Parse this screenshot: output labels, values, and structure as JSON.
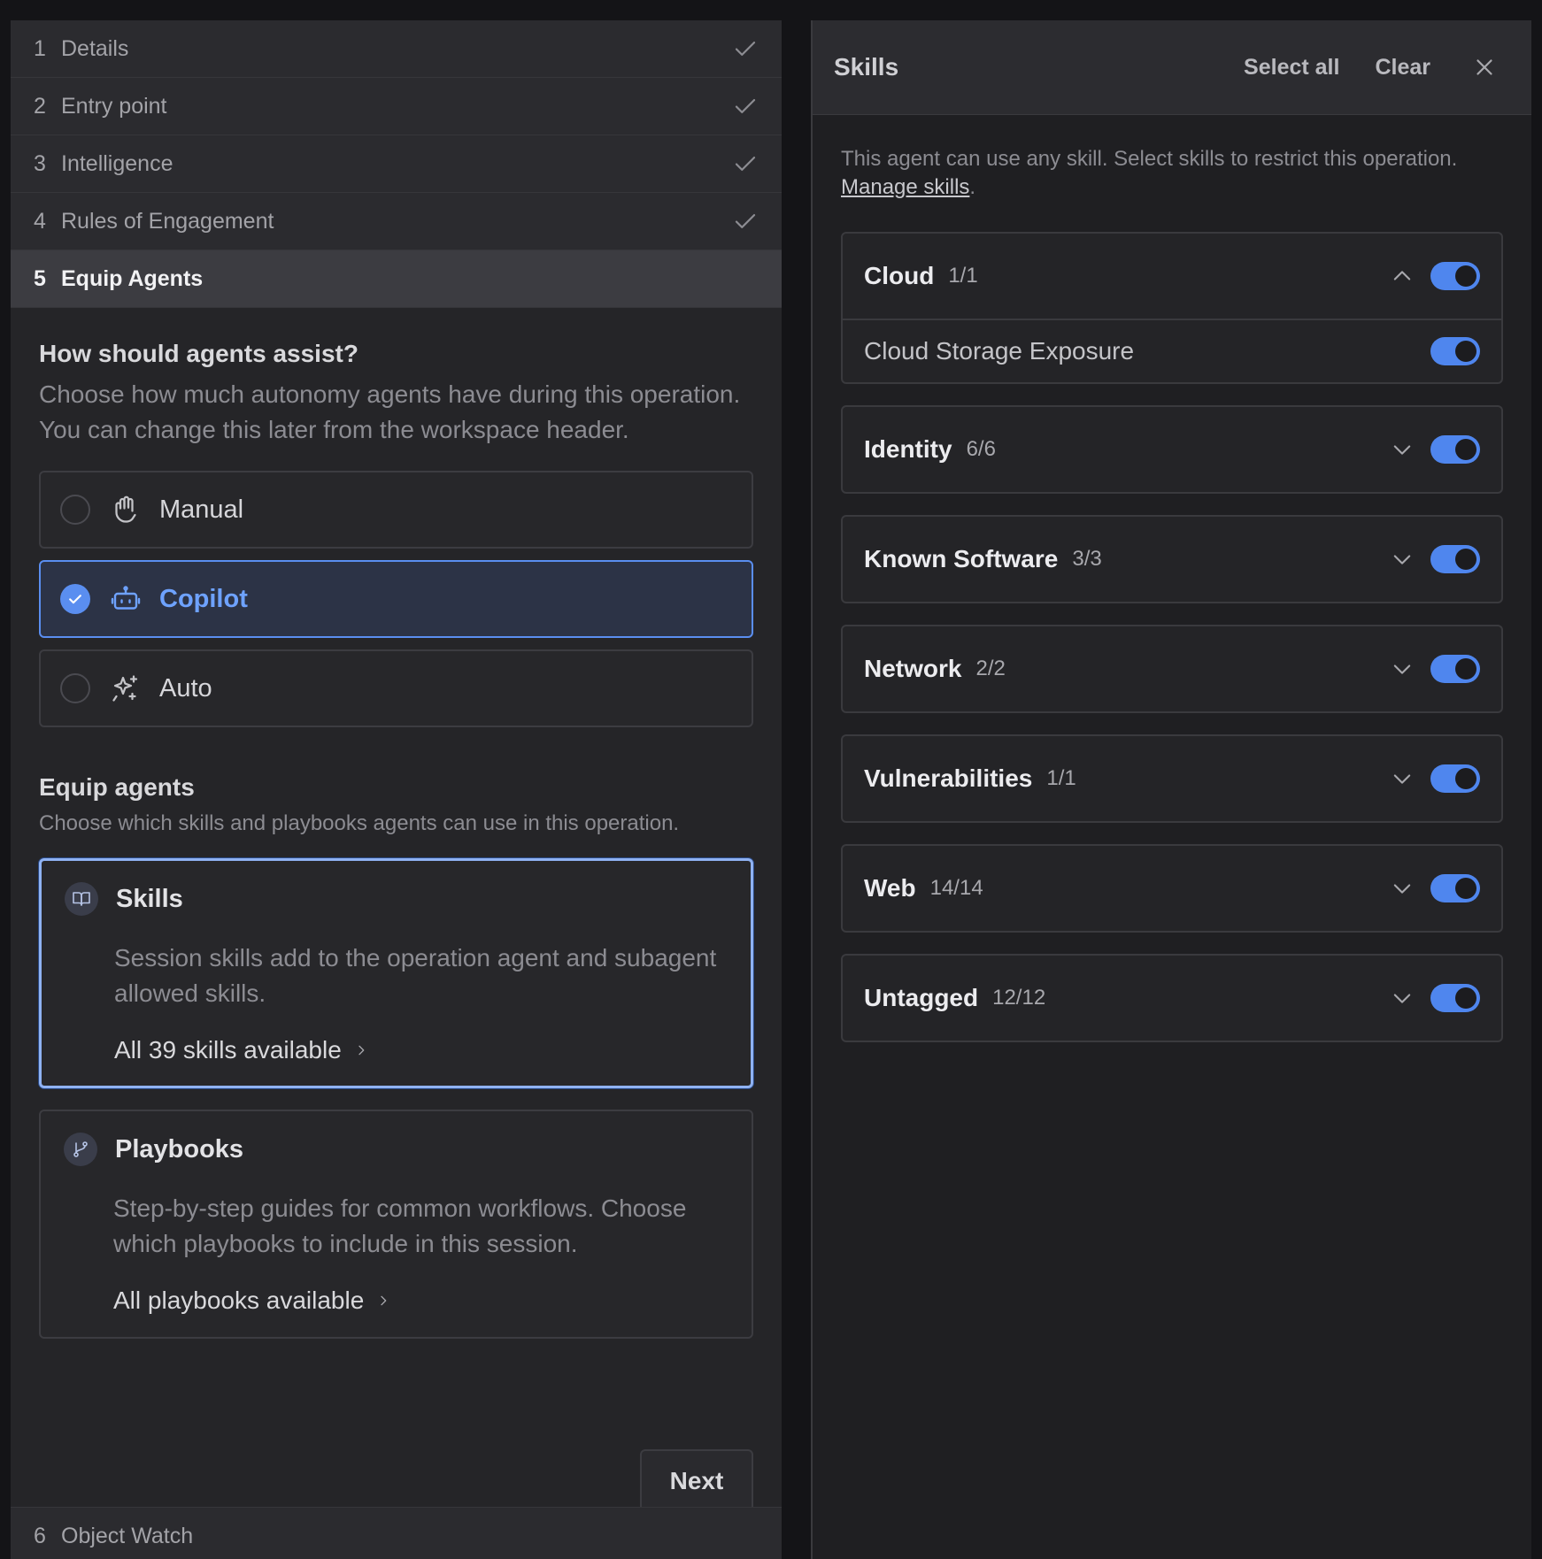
{
  "wizard": {
    "steps": [
      {
        "num": "1",
        "label": "Details"
      },
      {
        "num": "2",
        "label": "Entry point"
      },
      {
        "num": "3",
        "label": "Intelligence"
      },
      {
        "num": "4",
        "label": "Rules of Engagement"
      },
      {
        "num": "5",
        "label": "Equip Agents"
      },
      {
        "num": "6",
        "label": "Object Watch"
      }
    ],
    "assist": {
      "title": "How should agents assist?",
      "description": "Choose how much autonomy agents have during this operation. You can change this later from the workspace header.",
      "options": [
        {
          "label": "Manual",
          "icon": "hand-icon",
          "selected": false
        },
        {
          "label": "Copilot",
          "icon": "robot-icon",
          "selected": true
        },
        {
          "label": "Auto",
          "icon": "sparkles-icon",
          "selected": false
        }
      ]
    },
    "equip": {
      "title": "Equip agents",
      "description": "Choose which skills and playbooks agents can use in this operation.",
      "skills": {
        "title": "Skills",
        "description": "Session skills add to the operation agent and subagent allowed skills.",
        "link": "All 39 skills available"
      },
      "playbooks": {
        "title": "Playbooks",
        "description": "Step-by-step guides for common workflows. Choose which playbooks to include in this session.",
        "link": "All playbooks available"
      }
    },
    "next_label": "Next"
  },
  "drawer": {
    "title": "Skills",
    "select_all": "Select all",
    "clear": "Clear",
    "intro": "This agent can use any skill. Select skills to restrict this operation.",
    "manage_link": "Manage skills",
    "categories": [
      {
        "name": "Cloud",
        "count": "1/1",
        "expanded": true,
        "enabled": true,
        "skills": [
          {
            "name": "Cloud Storage Exposure",
            "enabled": true
          }
        ]
      },
      {
        "name": "Identity",
        "count": "6/6",
        "expanded": false,
        "enabled": true
      },
      {
        "name": "Known Software",
        "count": "3/3",
        "expanded": false,
        "enabled": true
      },
      {
        "name": "Network",
        "count": "2/2",
        "expanded": false,
        "enabled": true
      },
      {
        "name": "Vulnerabilities",
        "count": "1/1",
        "expanded": false,
        "enabled": true
      },
      {
        "name": "Web",
        "count": "14/14",
        "expanded": false,
        "enabled": true
      },
      {
        "name": "Untagged",
        "count": "12/12",
        "expanded": false,
        "enabled": true
      }
    ]
  },
  "colors": {
    "accent": "#5a8ef0",
    "toggle_on": "#4f86ee",
    "background": "#141417"
  }
}
